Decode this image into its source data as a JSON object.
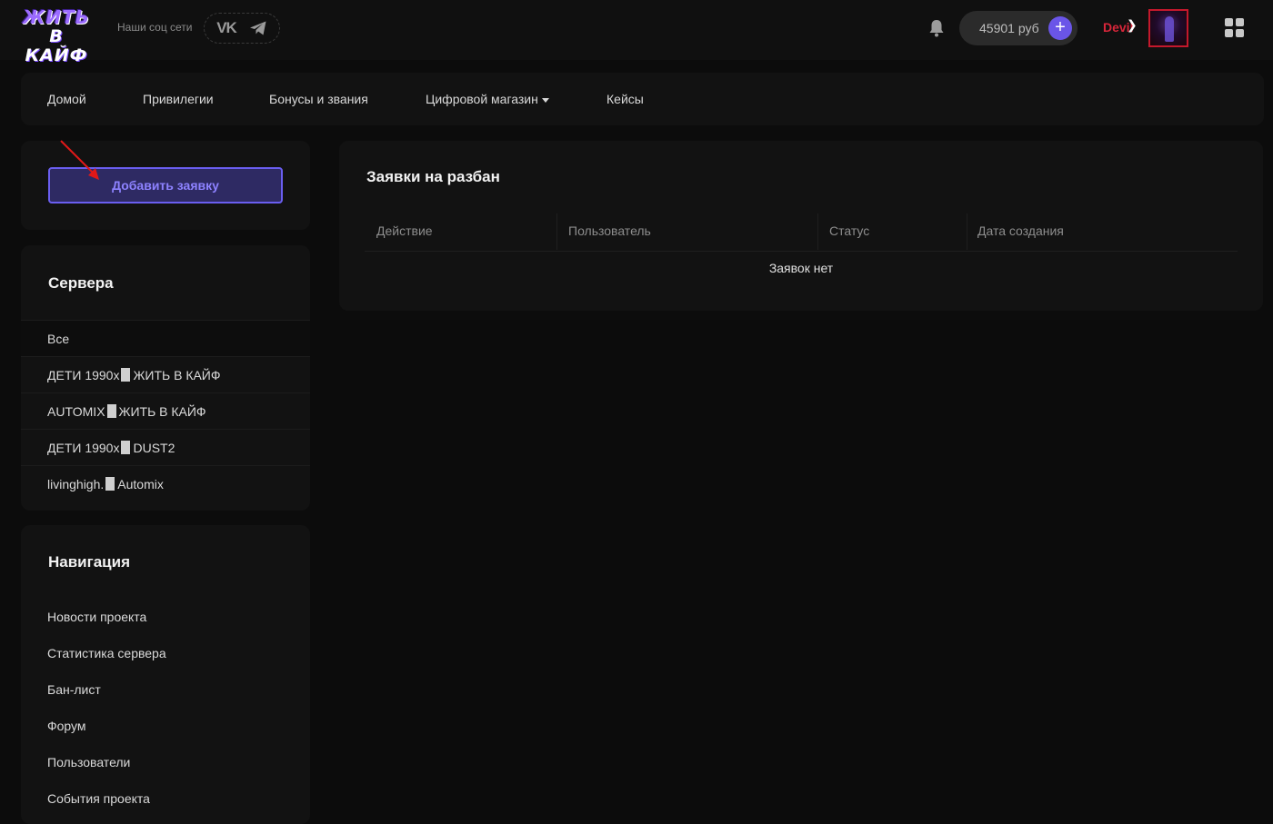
{
  "header": {
    "logo_line1": "ЖИТЬ",
    "logo_line2": "В КАЙФ",
    "social_label": "Наши соц сети",
    "social_vk": "VK",
    "balance_amount": "45901 руб",
    "balance_plus": "+",
    "nickname": "Devil",
    "nickname_mark": "❯"
  },
  "nav": {
    "items": [
      {
        "label": "Домой"
      },
      {
        "label": "Привилегии"
      },
      {
        "label": "Бонусы и звания"
      },
      {
        "label": "Цифровой магазин"
      },
      {
        "label": "Кейсы"
      }
    ]
  },
  "sidebar": {
    "add_button": "Добавить заявку",
    "servers_title": "Сервера",
    "servers": [
      {
        "pre": "Все",
        "post": ""
      },
      {
        "pre": "ДЕТИ 1990x",
        "post": "ЖИТЬ В КАЙФ"
      },
      {
        "pre": "AUTOMIX",
        "post": "ЖИТЬ В КАЙФ"
      },
      {
        "pre": "ДЕТИ 1990x",
        "post": "DUST2"
      },
      {
        "pre": "livinghigh.",
        "post": "Automix"
      }
    ],
    "navigation_title": "Навигация",
    "navigation": [
      {
        "label": "Новости проекта"
      },
      {
        "label": "Статистика сервера"
      },
      {
        "label": "Бан-лист"
      },
      {
        "label": "Форум"
      },
      {
        "label": "Пользователи"
      },
      {
        "label": "События проекта"
      }
    ]
  },
  "main": {
    "title": "Заявки на разбан",
    "columns": [
      {
        "label": "Действие"
      },
      {
        "label": "Пользователь"
      },
      {
        "label": "Статус"
      },
      {
        "label": "Дата создания"
      }
    ],
    "empty_text": "Заявок нет"
  },
  "colors": {
    "accent": "#6a55e8",
    "background": "#0c0c0c",
    "card": "#121212",
    "nick": "#d8263a"
  }
}
